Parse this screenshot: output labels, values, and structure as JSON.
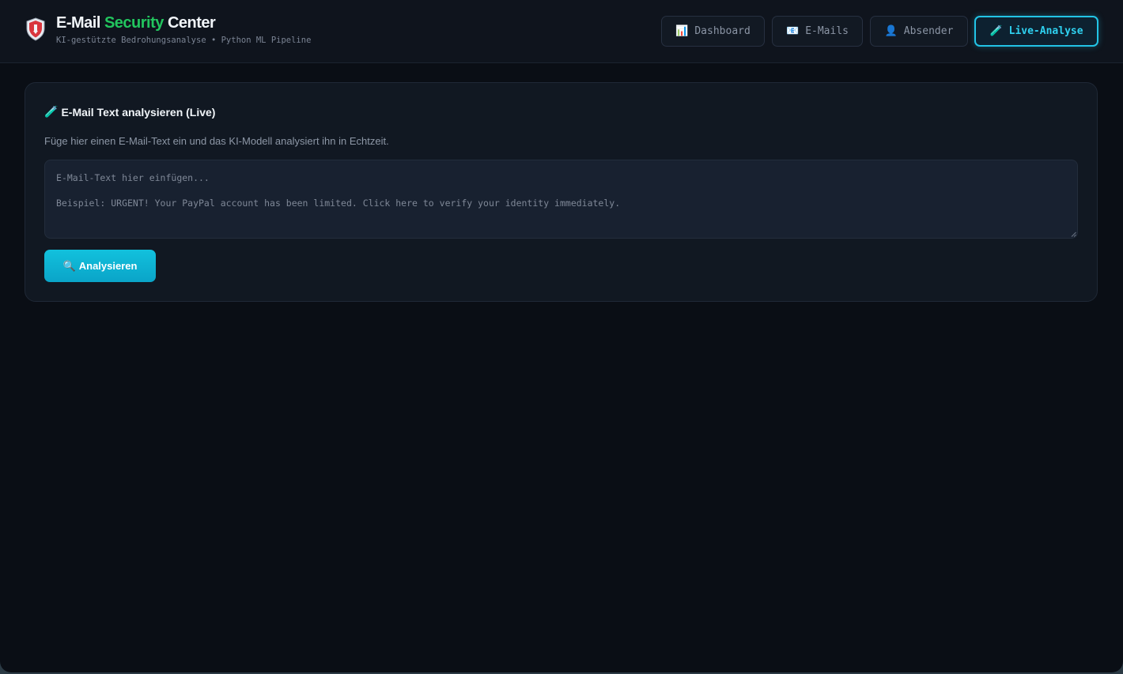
{
  "header": {
    "title_part1": "E-Mail ",
    "title_accent": "Security",
    "title_part3": " Center",
    "subtitle": "KI-gestützte Bedrohungsanalyse • Python ML Pipeline",
    "accent_color": "#22c55e"
  },
  "nav": [
    {
      "icon": "📊",
      "icon_name": "bar-chart-icon",
      "label": "Dashboard",
      "active": false
    },
    {
      "icon": "📧",
      "icon_name": "envelope-icon",
      "label": "E-Mails",
      "active": false
    },
    {
      "icon": "👤",
      "icon_name": "user-icon",
      "label": "Absender",
      "active": false
    },
    {
      "icon": "🧪",
      "icon_name": "test-tube-icon",
      "label": "Live-Analyse",
      "active": true
    }
  ],
  "panel": {
    "title_icon": "🧪",
    "title": "E-Mail Text analysieren (Live)",
    "description": "Füge hier einen E-Mail-Text ein und das KI-Modell analysiert ihn in Echtzeit.",
    "textarea_value": "",
    "textarea_placeholder": "E-Mail-Text hier einfügen...\n\nBeispiel: URGENT! Your PayPal account has been limited. Click here to verify your identity immediately.",
    "button_icon": "🔍",
    "button_label": "Analysieren"
  },
  "colors": {
    "background": "#0a0e15",
    "active_accent": "#22c4e6",
    "button": "#0fb5d4"
  }
}
